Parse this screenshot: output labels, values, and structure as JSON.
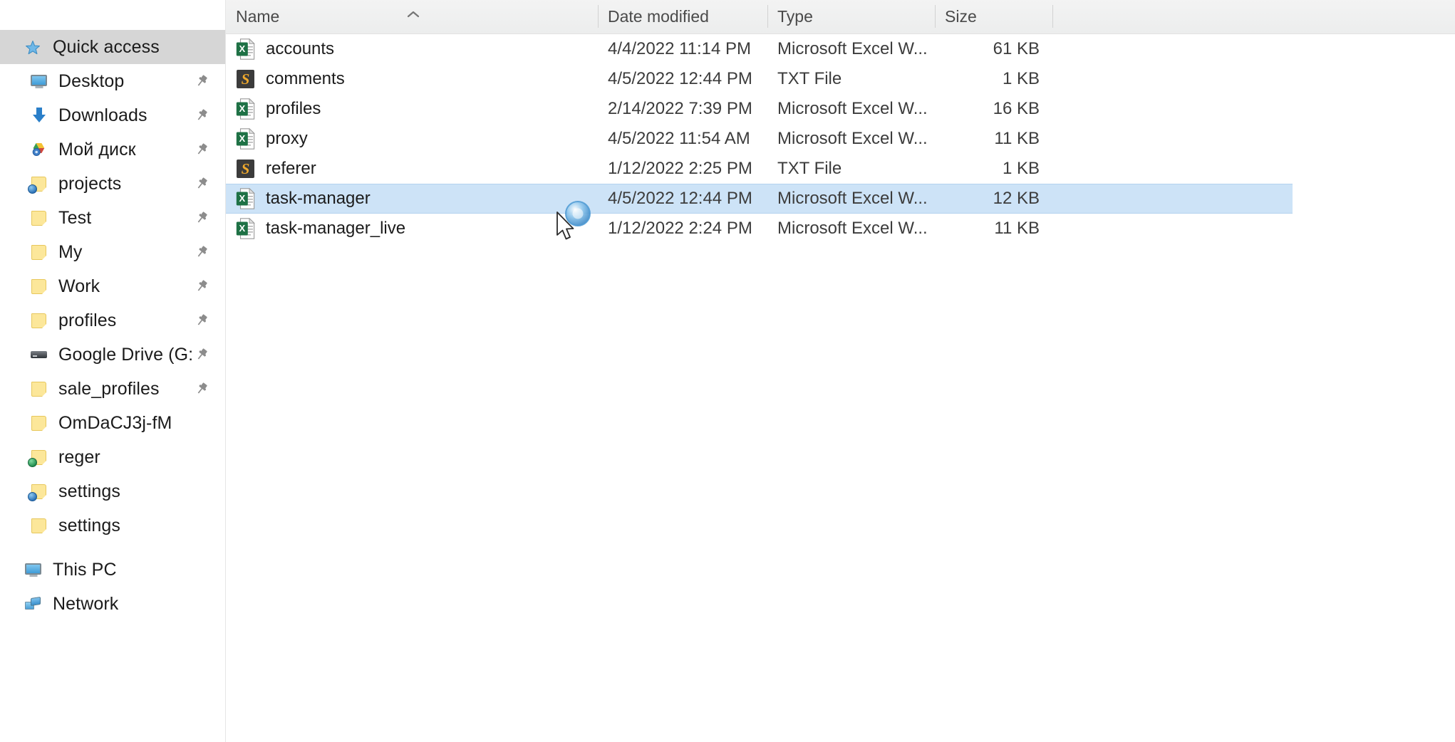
{
  "app": {
    "name": "Windows File Explorer",
    "accent_selected_row": "#cde3f7",
    "accent_nav_selected": "#d6d6d6"
  },
  "nav_pane": {
    "items": [
      {
        "label": "Quick access",
        "icon": "star-icon",
        "selected": true,
        "pinned": false,
        "indent": "root"
      },
      {
        "label": "Desktop",
        "icon": "desktop-icon",
        "selected": false,
        "pinned": true,
        "indent": "child"
      },
      {
        "label": "Downloads",
        "icon": "download-icon",
        "selected": false,
        "pinned": true,
        "indent": "child"
      },
      {
        "label": "Мой диск",
        "icon": "google-drive-icon",
        "selected": false,
        "pinned": true,
        "indent": "child"
      },
      {
        "label": "projects",
        "icon": "folder-sync-icon",
        "selected": false,
        "pinned": true,
        "indent": "child"
      },
      {
        "label": "Test",
        "icon": "folder-icon",
        "selected": false,
        "pinned": true,
        "indent": "child"
      },
      {
        "label": "My",
        "icon": "folder-icon",
        "selected": false,
        "pinned": true,
        "indent": "child"
      },
      {
        "label": "Work",
        "icon": "folder-icon",
        "selected": false,
        "pinned": true,
        "indent": "child"
      },
      {
        "label": "profiles",
        "icon": "folder-icon",
        "selected": false,
        "pinned": true,
        "indent": "child"
      },
      {
        "label": "Google Drive (G:",
        "icon": "drive-icon",
        "selected": false,
        "pinned": true,
        "indent": "child"
      },
      {
        "label": "sale_profiles",
        "icon": "folder-icon",
        "selected": false,
        "pinned": true,
        "indent": "child"
      },
      {
        "label": "OmDaCJ3j-fM",
        "icon": "folder-icon",
        "selected": false,
        "pinned": false,
        "indent": "child"
      },
      {
        "label": "reger",
        "icon": "folder-sync-green-icon",
        "selected": false,
        "pinned": false,
        "indent": "child"
      },
      {
        "label": "settings",
        "icon": "folder-sync-icon",
        "selected": false,
        "pinned": false,
        "indent": "child"
      },
      {
        "label": "settings",
        "icon": "folder-icon",
        "selected": false,
        "pinned": false,
        "indent": "child"
      },
      {
        "label": "This PC",
        "icon": "this-pc-icon",
        "selected": false,
        "pinned": false,
        "indent": "root"
      },
      {
        "label": "Network",
        "icon": "network-icon",
        "selected": false,
        "pinned": false,
        "indent": "root"
      }
    ]
  },
  "file_list": {
    "columns": [
      {
        "key": "name",
        "label": "Name",
        "sorted": true,
        "sort_direction": "ascending"
      },
      {
        "key": "date",
        "label": "Date modified",
        "sorted": false,
        "sort_direction": ""
      },
      {
        "key": "type",
        "label": "Type",
        "sorted": false,
        "sort_direction": ""
      },
      {
        "key": "size",
        "label": "Size",
        "sorted": false,
        "sort_direction": ""
      }
    ],
    "rows": [
      {
        "name": "accounts",
        "date": "4/4/2022 11:14 PM",
        "type": "Microsoft Excel W...",
        "size": "61 KB",
        "icon": "excel-file-icon",
        "selected": false
      },
      {
        "name": "comments",
        "date": "4/5/2022 12:44 PM",
        "type": "TXT File",
        "size": "1 KB",
        "icon": "sublime-file-icon",
        "selected": false
      },
      {
        "name": "profiles",
        "date": "2/14/2022 7:39 PM",
        "type": "Microsoft Excel W...",
        "size": "16 KB",
        "icon": "excel-file-icon",
        "selected": false
      },
      {
        "name": "proxy",
        "date": "4/5/2022 11:54 AM",
        "type": "Microsoft Excel W...",
        "size": "11 KB",
        "icon": "excel-file-icon",
        "selected": false
      },
      {
        "name": "referer",
        "date": "1/12/2022 2:25 PM",
        "type": "TXT File",
        "size": "1 KB",
        "icon": "sublime-file-icon",
        "selected": false
      },
      {
        "name": "task-manager",
        "date": "4/5/2022 12:44 PM",
        "type": "Microsoft Excel W...",
        "size": "12 KB",
        "icon": "excel-file-icon",
        "selected": true
      },
      {
        "name": "task-manager_live",
        "date": "1/12/2022 2:24 PM",
        "type": "Microsoft Excel W...",
        "size": "11 KB",
        "icon": "excel-file-icon",
        "selected": false
      }
    ],
    "item_count": 7
  },
  "pointer": {
    "cursor": "arrow-busy-cursor",
    "busy": true,
    "hovered_item": "task-manager"
  }
}
